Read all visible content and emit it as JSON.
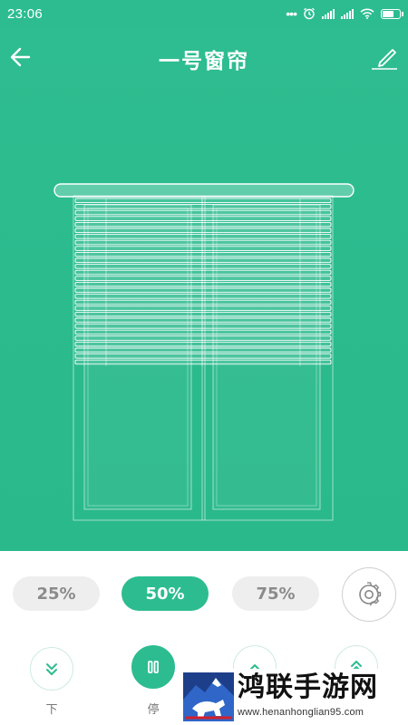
{
  "status_bar": {
    "time": "23:06",
    "dots": "•••"
  },
  "header": {
    "title": "一号窗帘",
    "back_icon": "arrow-left-icon",
    "edit_icon": "pencil-icon"
  },
  "curtain": {
    "illustration": "venetian-blind-over-window",
    "open_level_percent": 50
  },
  "presets": [
    {
      "label": "25%",
      "active": false
    },
    {
      "label": "50%",
      "active": true
    },
    {
      "label": "75%",
      "active": false
    }
  ],
  "settings_icon": "gear-icon",
  "controls": [
    {
      "icon": "double-chevron-down-icon",
      "label": "下"
    },
    {
      "icon": "pause-icon",
      "label": "停"
    },
    {
      "icon": "chevron-up-icon",
      "label": ""
    },
    {
      "icon": "double-chevron-up-icon",
      "label": ""
    }
  ],
  "watermark": {
    "title": "鸿联手游网",
    "url": "www.henanhonglian95.com"
  },
  "colors": {
    "accent": "#2cbc90",
    "chip_bg": "#eeeeee",
    "chip_text": "#8b8b8b"
  }
}
